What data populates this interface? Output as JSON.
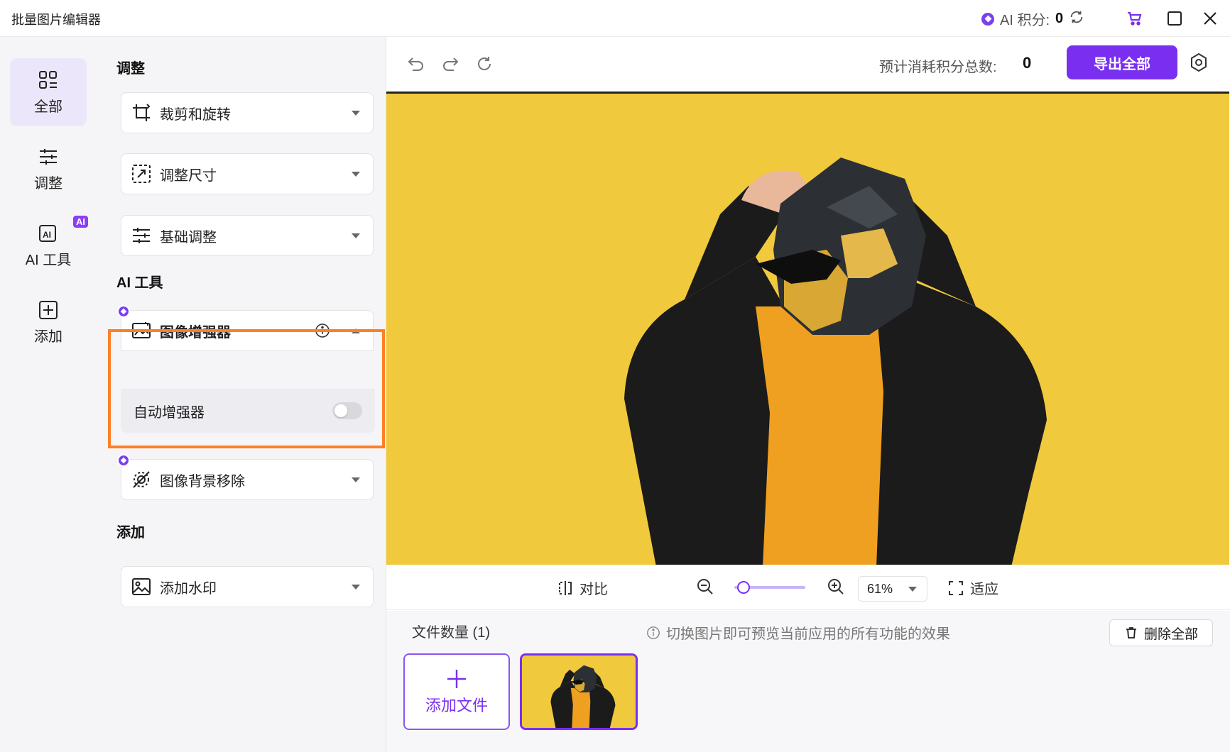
{
  "app": {
    "title": "批量图片编辑器"
  },
  "titlebar": {
    "ai_label": "AI 积分:",
    "ai_value": "0"
  },
  "nav": {
    "items": [
      {
        "label": "全部",
        "icon": "grid-icon"
      },
      {
        "label": "调整",
        "icon": "sliders-icon"
      },
      {
        "label": "AI 工具",
        "icon": "ai-icon",
        "badge": "AI"
      },
      {
        "label": "添加",
        "icon": "plus-square-icon"
      }
    ]
  },
  "panel": {
    "adjust_title": "调整",
    "ai_title": "AI 工具",
    "add_title": "添加",
    "tools": {
      "crop": "裁剪和旋转",
      "resize": "调整尺寸",
      "basic": "基础调整",
      "enhancer": "图像增强器",
      "auto_enhancer": "自动增强器",
      "bg_remove": "图像背景移除",
      "watermark": "添加水印"
    }
  },
  "toolbar": {
    "estimate_label": "预计消耗积分总数:",
    "estimate_value": "0",
    "export_label": "导出全部"
  },
  "zoom": {
    "compare_label": "对比",
    "zoom_level": "61%",
    "zoom_fraction": 0.05,
    "fit_label": "适应"
  },
  "files": {
    "count_label": "文件数量 (1)",
    "hint": "切换图片即可预览当前应用的所有功能的效果",
    "delete_label": "删除全部",
    "add_label": "添加文件"
  },
  "colors": {
    "accent": "#7a2ff0",
    "highlight": "#ff7f24",
    "canvas_bg": "#f1c93c"
  }
}
